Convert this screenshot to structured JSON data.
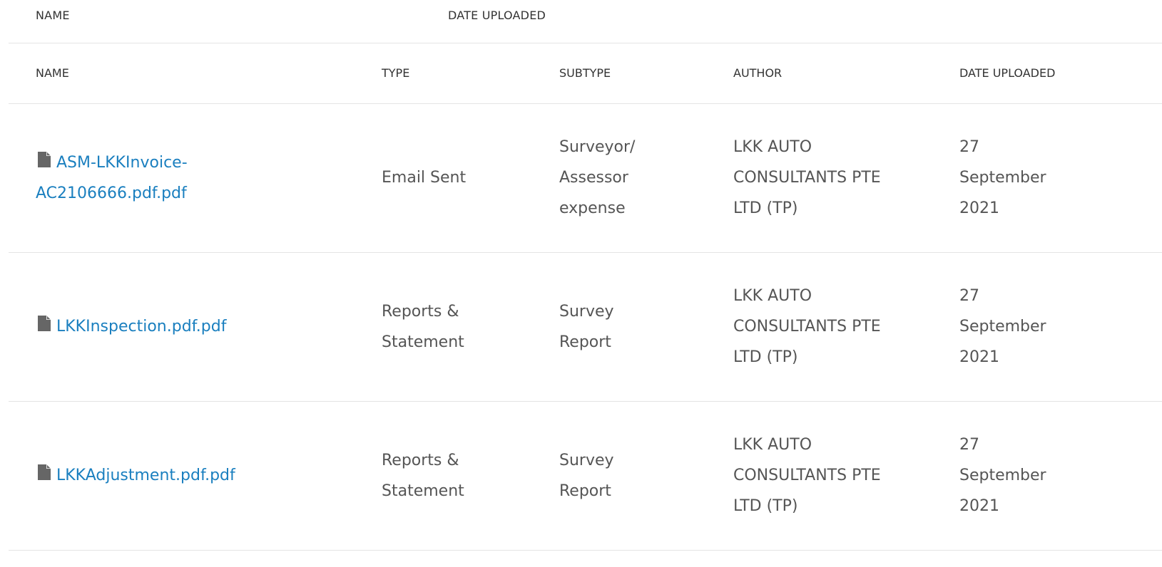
{
  "sticky_header": {
    "name_label": "NAME",
    "date_label": "DATE UPLOADED"
  },
  "table": {
    "columns": {
      "name": "NAME",
      "type": "TYPE",
      "subtype": "SUBTYPE",
      "author": "AUTHOR",
      "date": "DATE UPLOADED"
    },
    "rows": [
      {
        "name": "ASM-LKKInvoice-AC2106666.pdf.pdf",
        "type": "Email Sent",
        "subtype": "Surveyor/ Assessor expense",
        "author": "LKK AUTO CONSULTANTS PTE LTD (TP)",
        "date": "27 September 2021",
        "icon": "file-icon"
      },
      {
        "name": "LKKInspection.pdf.pdf",
        "type": "Reports & Statement",
        "subtype": "Survey Report",
        "author": "LKK AUTO CONSULTANTS PTE LTD (TP)",
        "date": "27 September 2021",
        "icon": "file-icon"
      },
      {
        "name": "LKKAdjustment.pdf.pdf",
        "type": "Reports & Statement",
        "subtype": "Survey Report",
        "author": "LKK AUTO CONSULTANTS PTE LTD (TP)",
        "date": "27 September 2021",
        "icon": "file-icon"
      }
    ]
  },
  "colors": {
    "link": "#1a7fbf",
    "text": "#555555",
    "header_text": "#333333",
    "divider": "#e4e4e4",
    "icon": "#666666"
  }
}
